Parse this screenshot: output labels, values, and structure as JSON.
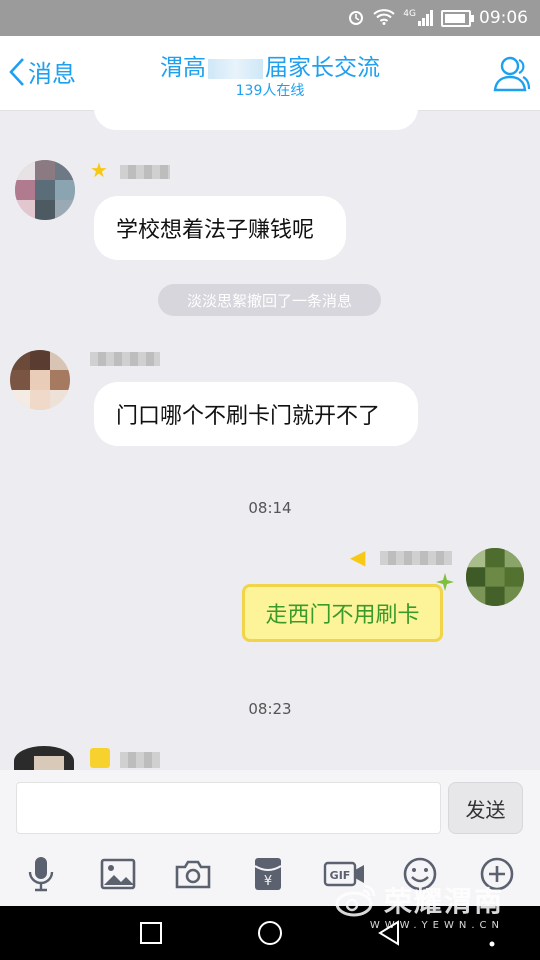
{
  "status_bar": {
    "time": "09:06",
    "signal_label": "4G",
    "battery_level": 0.9
  },
  "header": {
    "back_label": "消息",
    "title_prefix": "渭高",
    "title_suffix": "届家长交流",
    "online": "139人在线"
  },
  "messages": [
    {
      "type": "text",
      "side": "left",
      "text": "学校想着法子赚钱呢"
    },
    {
      "type": "system",
      "text": "淡淡思絮撤回了一条消息"
    },
    {
      "type": "text",
      "side": "left",
      "text": "门口哪个不刷卡门就开不了"
    },
    {
      "type": "time",
      "text": "08:14"
    },
    {
      "type": "text",
      "side": "right",
      "text": "走西门不用刷卡"
    },
    {
      "type": "time",
      "text": "08:23"
    }
  ],
  "input": {
    "value": "",
    "send_label": "发送"
  },
  "toolbar": [
    "microphone-icon",
    "image-icon",
    "camera-icon",
    "red-packet-icon",
    "gif-icon",
    "emoji-icon",
    "plus-icon"
  ],
  "watermark": {
    "brand": "荣耀渭南",
    "url": "WWW.YEWN.CN"
  },
  "colors": {
    "accent": "#1ea0f0",
    "my_bubble": "#fdf49a",
    "my_text": "#3a9a2a",
    "background": "#ececf1"
  }
}
